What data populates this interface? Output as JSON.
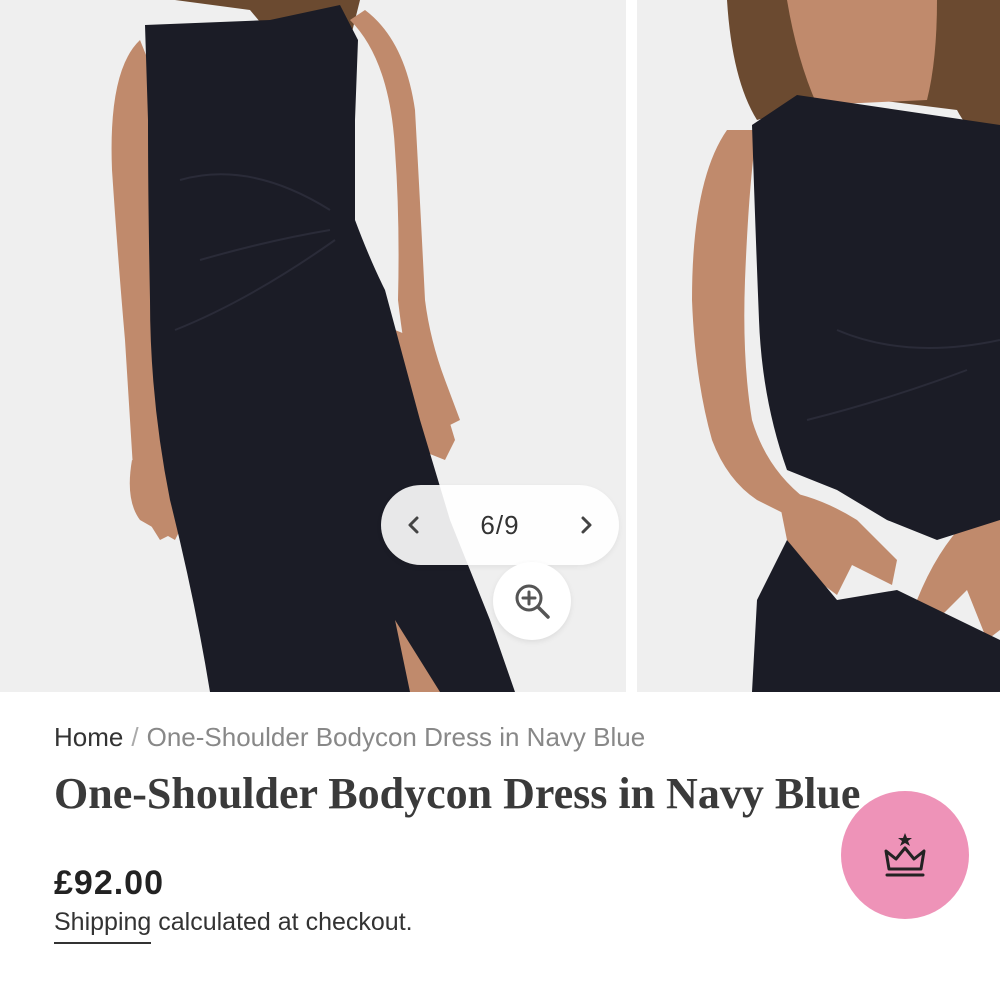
{
  "gallery": {
    "counter": "6/9",
    "images": [
      {
        "alt": "model-front"
      },
      {
        "alt": "model-closeup"
      }
    ]
  },
  "breadcrumb": {
    "home": "Home",
    "separator": "/",
    "current": "One-Shoulder Bodycon Dress in Navy Blue"
  },
  "product": {
    "title": "One-Shoulder Bodycon Dress in Navy Blue",
    "price": "£92.00",
    "shipping_link": "Shipping",
    "shipping_rest": " calculated at checkout."
  },
  "icons": {
    "prev": "chevron-left-icon",
    "next": "chevron-right-icon",
    "zoom": "zoom-in-icon",
    "reward": "crown-icon"
  },
  "colors": {
    "dress": "#1b1c26",
    "skin": "#c08a6c",
    "hair": "#6b4a30",
    "photo_bg": "#efefef",
    "reward_btn": "#ee93b8"
  }
}
